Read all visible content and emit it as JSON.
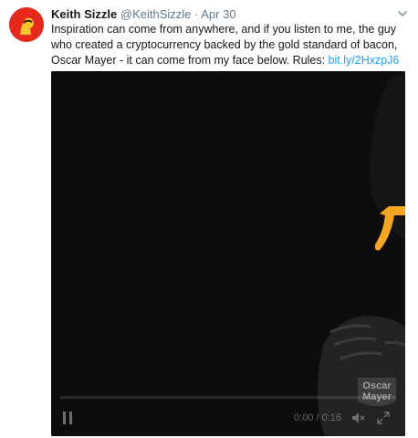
{
  "tweet": {
    "author_name": "Keith Sizzle",
    "handle": "@KeithSizzle",
    "separator": "·",
    "date": "Apr 30",
    "text": "Inspiration can come from anywhere, and if you listen to me, the guy who created a cryptocurrency backed by the gold standard of bacon, Oscar Mayer - it can come from my face below. Rules: ",
    "link": "bit.ly/2HxzpJ6"
  },
  "media": {
    "time": "0:00 / 0:16",
    "logo_text_line1": "Oscar",
    "logo_text_line2": "Mayer",
    "progress_fraction": 0
  },
  "colors": {
    "link": "#1da1f2",
    "media_bg": "#0d0d0d",
    "accent": "#f5a623",
    "avatar_bg": "#e52a1d"
  }
}
